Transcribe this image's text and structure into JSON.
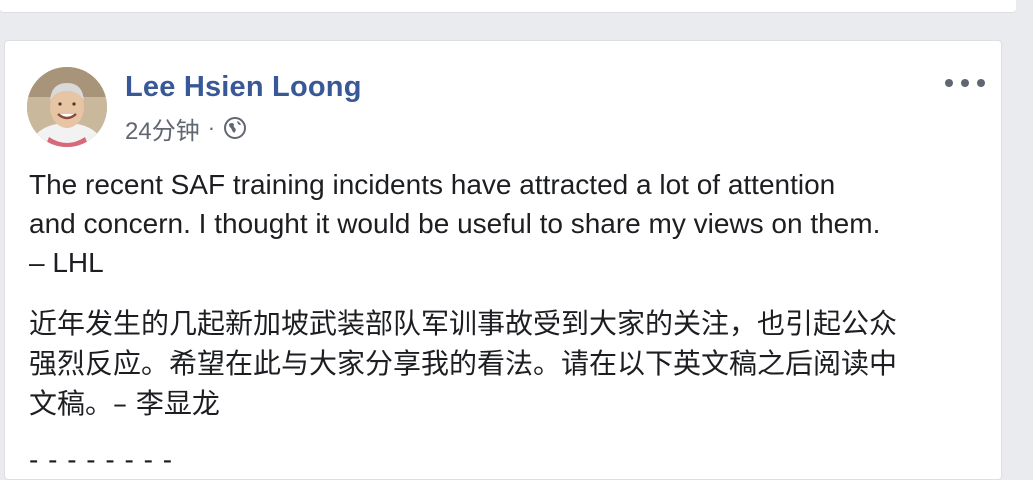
{
  "post": {
    "author": "Lee Hsien Loong",
    "timestamp": "24分钟",
    "separator": "·",
    "privacy_icon": "globe-icon",
    "more_icon": "more-options-icon",
    "text_en_line1": "The recent SAF training incidents have attracted a lot of attention",
    "text_en_line2": "and concern. I thought it would be useful to share my views on them.",
    "text_en_line3": "– LHL",
    "text_zh_line1": "近年发生的几起新加坡武装部队军训事故受到大家的关注，也引起公众",
    "text_zh_line2": "强烈反应。希望在此与大家分享我的看法。请在以下英文稿之后阅读中",
    "text_zh_line3": "文稿。– 李显龙",
    "divider_text": "- - - - - - - -"
  },
  "colors": {
    "page_bg": "#e9ebee",
    "card_bg": "#ffffff",
    "author_link": "#385898",
    "meta_text": "#616770",
    "body_text": "#1c1e21"
  }
}
